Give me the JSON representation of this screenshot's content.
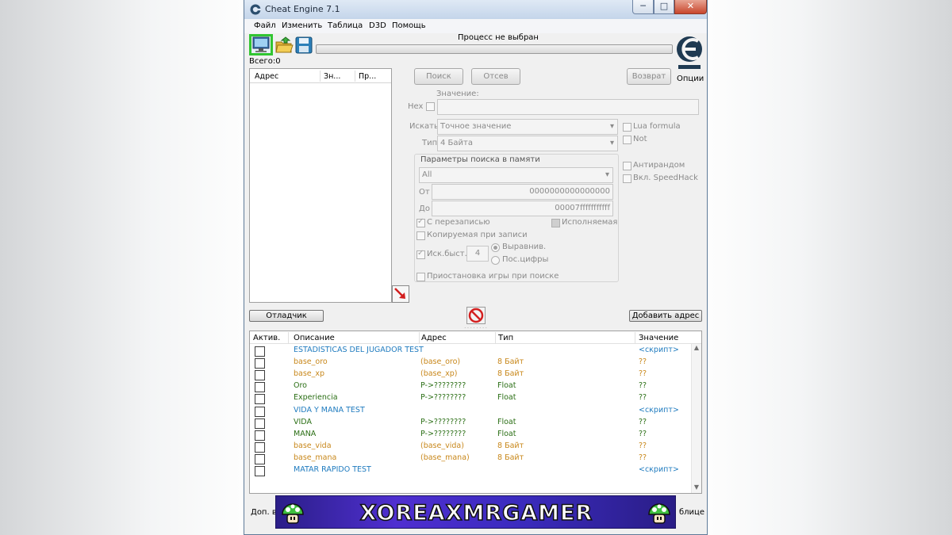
{
  "window": {
    "title": "Cheat Engine 7.1",
    "min_glyph": "─",
    "max_glyph": "□",
    "close_glyph": "✕"
  },
  "menu": [
    "Файл",
    "Изменить",
    "Таблица",
    "D3D",
    "Помощь"
  ],
  "toolbar": {
    "process_status": "Процесс не выбран",
    "total_label": "Всего:0",
    "options_label": "Опции"
  },
  "found_list": {
    "columns": [
      "Адрес",
      "Зн...",
      "Пр..."
    ]
  },
  "scan": {
    "first_scan": "Поиск",
    "next_scan": "Отсев",
    "undo_scan": "Возврат",
    "value_label": "Значение:",
    "hex_label": "Hex",
    "scan_type_label": "Искать",
    "scan_type_value": "Точное значение",
    "value_type_label": "Тип",
    "value_type_value": "4 Байта",
    "lua_formula": "Lua formula",
    "not_label": "Not",
    "antirandom": "Антирандом",
    "speedhack": "Вкл. SpeedHack"
  },
  "memory": {
    "title": "Параметры поиска в памяти",
    "region": "All",
    "from_label": "От",
    "from_value": "0000000000000000",
    "to_label": "До",
    "to_value": "00007fffffffffff",
    "writable": "С перезаписью",
    "executable": "Исполняемая",
    "copy_on_write": "Копируемая при записи",
    "fast_scan": "Иск.быст.",
    "fast_scan_value": "4",
    "alignment": "Выравнив.",
    "last_digits": "Пос.цифры",
    "pause_game": "Приостановка игры при поиске"
  },
  "bottom": {
    "debugger_button": "Отладчик",
    "add_address_button": "Добавить адрес"
  },
  "cheat_table": {
    "columns": [
      "Актив.",
      "Описание",
      "Адрес",
      "Тип",
      "Значение"
    ],
    "rows": [
      {
        "desc": "ESTADISTICAS DEL JUGADOR TEST",
        "address": "",
        "type": "",
        "value": "<скрипт>",
        "color": "blue"
      },
      {
        "desc": "base_oro",
        "address": "(base_oro)",
        "type": "8 Байт",
        "value": "??",
        "color": "orange"
      },
      {
        "desc": "base_xp",
        "address": "(base_xp)",
        "type": "8 Байт",
        "value": "??",
        "color": "orange"
      },
      {
        "desc": "Oro",
        "address": "P->????????",
        "type": "Float",
        "value": "??",
        "color": "green"
      },
      {
        "desc": "Experiencia",
        "address": "P->????????",
        "type": "Float",
        "value": "??",
        "color": "green"
      },
      {
        "desc": "VIDA Y MANA TEST",
        "address": "",
        "type": "",
        "value": "<скрипт>",
        "color": "blue"
      },
      {
        "desc": "VIDA",
        "address": "P->????????",
        "type": "Float",
        "value": "??",
        "color": "green"
      },
      {
        "desc": "MANA",
        "address": "P->????????",
        "type": "Float",
        "value": "??",
        "color": "green"
      },
      {
        "desc": "base_vida",
        "address": "(base_vida)",
        "type": "8 Байт",
        "value": "??",
        "color": "orange"
      },
      {
        "desc": "base_mana",
        "address": "(base_mana)",
        "type": "8 Байт",
        "value": "??",
        "color": "orange"
      },
      {
        "desc": "MATAR RAPIDO TEST",
        "address": "",
        "type": "",
        "value": "<скрипт>",
        "color": "blue"
      }
    ]
  },
  "status": {
    "left": "Доп. во",
    "right": "блице"
  },
  "banner": {
    "text": "XOREAXMRGAMER"
  },
  "colors": {
    "blue_row": "#1f7bbf",
    "orange_row": "#c8871a",
    "green_row": "#2a6e14",
    "banner_bg": "#4f2fd0"
  }
}
